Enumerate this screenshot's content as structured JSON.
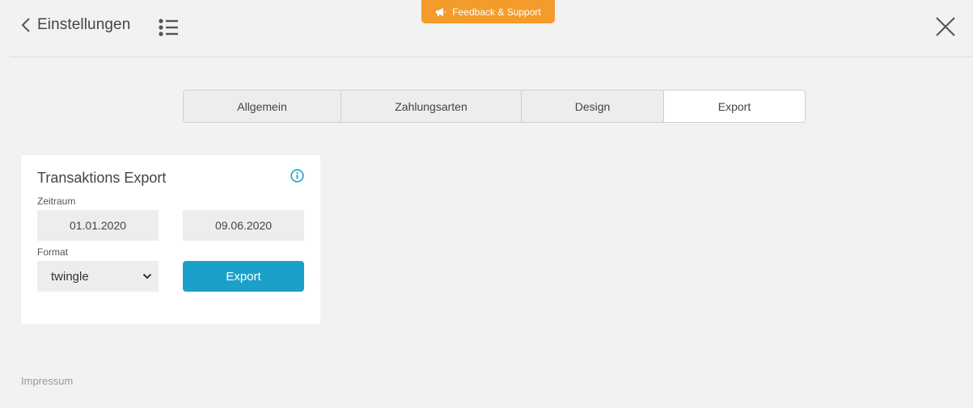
{
  "header": {
    "back_label": "Einstellungen",
    "back_icon": "chevron-left-icon",
    "menu_icon": "list-icon",
    "close_icon": "close-icon"
  },
  "feedback": {
    "label": "Feedback & Support",
    "icon": "megaphone-icon",
    "color": "#f39c2b"
  },
  "tabs": [
    {
      "label": "Allgemein",
      "active": false
    },
    {
      "label": "Zahlungsarten",
      "active": false
    },
    {
      "label": "Design",
      "active": false
    },
    {
      "label": "Export",
      "active": true
    }
  ],
  "export_card": {
    "title": "Transaktions Export",
    "info_icon": "info-icon",
    "period_label": "Zeitraum",
    "date_from": "01.01.2020",
    "date_to": "09.06.2020",
    "format_label": "Format",
    "format_value": "twingle",
    "export_label": "Export",
    "accent_color": "#1ba1c9"
  },
  "footer": {
    "impressum_label": "Impressum"
  }
}
